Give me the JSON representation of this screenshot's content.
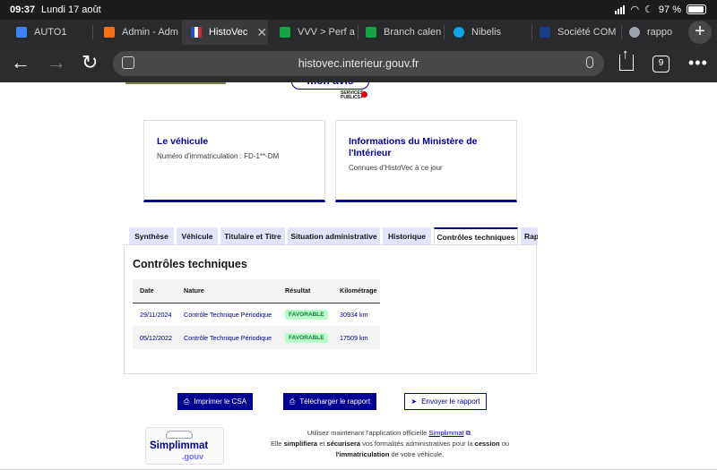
{
  "status": {
    "time": "09:37",
    "date": "Lundi 17 août",
    "battery": "97 %"
  },
  "tabs": [
    {
      "label": "AUTO1",
      "color": "#3b82f6"
    },
    {
      "label": "Admin - Adm",
      "color": "#f97316"
    },
    {
      "label": "HistoVec",
      "color": "#1d4ed8",
      "active": true
    },
    {
      "label": "VVV > Perf a",
      "color": "#16a34a"
    },
    {
      "label": "Branch calen",
      "color": "#16a34a"
    },
    {
      "label": "Nibelis",
      "color": "#0ea5e9"
    },
    {
      "label": "Société COM",
      "color": "#1e3a8a"
    },
    {
      "label": "rappo",
      "color": "#9ca3af"
    }
  ],
  "toolbar": {
    "url": "histovec.interieur.gouv.fr",
    "tab_count": "9"
  },
  "page": {
    "avis_label": "mon avis",
    "sp_logo_text": "SERVICES PUBLICS+",
    "card_vehicle": {
      "title": "Le véhicule",
      "text": "Numéro d'immatriculation : FD-1**-DM"
    },
    "card_ministry": {
      "title_line1": "Informations du Ministère de",
      "title_line2": "l'Intérieur",
      "text": "Connues d'HistoVec à ce jour"
    },
    "tabs": [
      "Synthèse",
      "Véhicule",
      "Titulaire et Titre",
      "Situation administrative",
      "Historique",
      "Contrôles techniques",
      "Rap"
    ],
    "active_tab": "Contrôles techniques",
    "section_title": "Contrôles techniques",
    "table": {
      "headers": [
        "Date",
        "Nature",
        "Résultat",
        "Kilométrage"
      ],
      "rows": [
        {
          "date": "29/11/2024",
          "nature": "Contrôle Technique Périodique",
          "result": "FAVORABLE",
          "km": "30934 km"
        },
        {
          "date": "05/12/2022",
          "nature": "Contrôle Technique Périodique",
          "result": "FAVORABLE",
          "km": "17509 km"
        }
      ]
    },
    "buttons": {
      "print": "Imprimer le CSA",
      "download": "Télécharger le rapport",
      "send": "Envoyer le rapport"
    },
    "simplimmat": {
      "word1": "Simplimmat",
      "word2": ".gouv"
    },
    "promo": {
      "line1_pre": "Utilisez maintenant l'application officielle",
      "line1_link": "Simplimmat",
      "line2_a": "Elle",
      "line2_b": "simplifiera",
      "line2_c": "et",
      "line2_d": "sécurisera",
      "line2_e": "vos formalités administratives pour la",
      "line2_f": "cession",
      "line2_g": "ou",
      "line3_a": "l'immatriculation",
      "line3_b": "de votre véhicule."
    }
  }
}
